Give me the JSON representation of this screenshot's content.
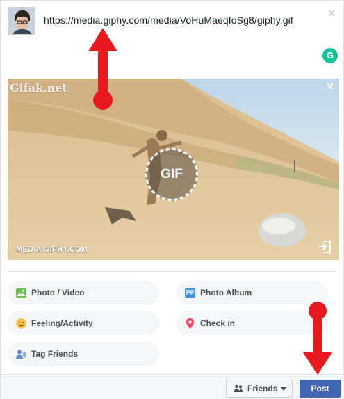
{
  "composer": {
    "post_text": "https://media.giphy.com/media/VoHuMaeqIoSg8/giphy.gif"
  },
  "gif": {
    "watermark": "Gifak.net",
    "badge_label": "GIF",
    "source_label": "MEDIA.GIPHY.COM"
  },
  "actions": [
    {
      "label": "Photo / Video",
      "icon": "photo-video-icon"
    },
    {
      "label": "Photo Album",
      "icon": "photo-album-icon"
    },
    {
      "label": "Feeling/Activity",
      "icon": "smiley-icon"
    },
    {
      "label": "Check in",
      "icon": "location-pin-icon"
    },
    {
      "label": "Tag Friends",
      "icon": "tag-friends-icon"
    }
  ],
  "footer": {
    "audience_label": "Friends",
    "post_label": "Post"
  },
  "colors": {
    "brand_blue": "#4267b2",
    "annotation_red": "#e8191f",
    "grammarly_green": "#15c39a"
  }
}
